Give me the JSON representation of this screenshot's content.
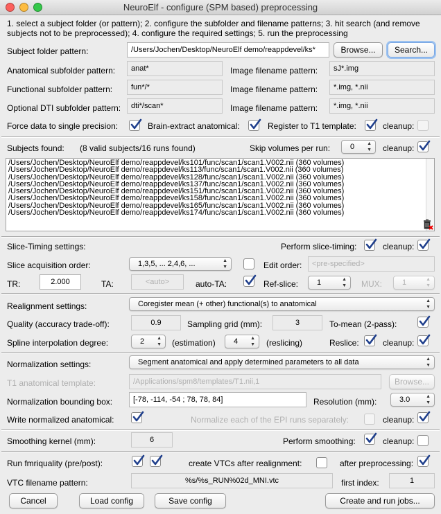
{
  "window": {
    "title": "NeuroElf - configure (SPM based) preprocessing"
  },
  "instructions": [
    "1. select a subject folder (or pattern); 2. configure the subfolder and filename patterns; 3. hit search (and remove",
    "subjects not to be preprocessed); 4. configure the required settings; 5. run the preprocessing"
  ],
  "folder": {
    "subject_label": "Subject folder pattern:",
    "subject_value": "/Users/Jochen/Desktop/NeuroElf demo/reappdevel/ks*",
    "browse": "Browse...",
    "search": "Search...",
    "anat_label": "Anatomical subfolder pattern:",
    "anat_value": "anat*",
    "anat_img_label": "Image filename pattern:",
    "anat_img_value": "sJ*.img",
    "func_label": "Functional subfolder pattern:",
    "func_value": "fun*/*",
    "func_img_label": "Image filename pattern:",
    "func_img_value": "*.img, *.nii",
    "dti_label": "Optional DTI subfolder pattern:",
    "dti_value": "dti*/scan*",
    "dti_img_label": "Image filename pattern:",
    "dti_img_value": "*.img, *.nii",
    "force_single": "Force data to single precision:",
    "brain_extract": "Brain-extract anatomical:",
    "register_t1": "Register to T1 template:",
    "cleanup": "cleanup:"
  },
  "subjects": {
    "label": "Subjects found:",
    "summary": "(8 valid subjects/16 runs found)",
    "skip_label": "Skip volumes per run:",
    "skip_value": "0",
    "cleanup": "cleanup:",
    "rows": [
      "/Users/Jochen/Desktop/NeuroElf demo/reappdevel/ks101/func/scan1/scan1.V002.nii (360 volumes)",
      "/Users/Jochen/Desktop/NeuroElf demo/reappdevel/ks113/func/scan1/scan1.V002.nii (360 volumes)",
      "/Users/Jochen/Desktop/NeuroElf demo/reappdevel/ks128/func/scan1/scan1.V002.nii (360 volumes)",
      "/Users/Jochen/Desktop/NeuroElf demo/reappdevel/ks137/func/scan1/scan1.V002.nii (360 volumes)",
      "/Users/Jochen/Desktop/NeuroElf demo/reappdevel/ks151/func/scan1/scan1.V002.nii (360 volumes)",
      "/Users/Jochen/Desktop/NeuroElf demo/reappdevel/ks158/func/scan1/scan1.V002.nii (360 volumes)",
      "/Users/Jochen/Desktop/NeuroElf demo/reappdevel/ks165/func/scan1/scan1.V002.nii (360 volumes)",
      "/Users/Jochen/Desktop/NeuroElf demo/reappdevel/ks174/func/scan1/scan1.V002.nii (360 volumes)"
    ],
    "trash_icon": "trash-icon"
  },
  "slice_timing": {
    "label": "Slice-Timing settings:",
    "perform_label": "Perform slice-timing:",
    "cleanup": "cleanup:",
    "order_label": "Slice acquisition order:",
    "order_value": "1,3,5, ... 2,4,6, ...",
    "edit_order_label": "Edit order:",
    "edit_order_value": "<pre-specified>",
    "tr_label": "TR:",
    "tr_value": "2.000",
    "ta_label": "TA:",
    "ta_value": "<auto>",
    "auto_ta_label": "auto-TA:",
    "ref_slice_label": "Ref-slice:",
    "ref_slice_value": "1",
    "mux_label": "MUX:",
    "mux_value": "1"
  },
  "realignment": {
    "label": "Realignment settings:",
    "mode_value": "Coregister mean (+ other) functional(s) to anatomical",
    "quality_label": "Quality (accuracy trade-off):",
    "quality_value": "0.9",
    "grid_label": "Sampling grid (mm):",
    "grid_value": "3",
    "to_mean_label": "To-mean (2-pass):",
    "spline_label": "Spline interpolation degree:",
    "spline_est_value": "2",
    "estimation_label": "(estimation)",
    "spline_res_value": "4",
    "reslicing_label": "(reslicing)",
    "reslice_label": "Reslice:",
    "cleanup": "cleanup:"
  },
  "normalization": {
    "label": "Normalization settings:",
    "mode_value": "Segment anatomical and apply determined parameters to all data",
    "template_label": "T1 anatomical template:",
    "template_value": "/Applications/spm8/templates/T1.nii,1",
    "browse": "Browse...",
    "bbox_label": "Normalization bounding box:",
    "bbox_value": "[-78, -114, -54 ; 78, 78, 84]",
    "resolution_label": "Resolution (mm):",
    "resolution_value": "3.0",
    "write_anat_label": "Write normalized anatomical:",
    "normalize_each_label": "Normalize each of the EPI runs separately:",
    "cleanup": "cleanup:"
  },
  "smoothing": {
    "label": "Smoothing kernel (mm):",
    "value": "6",
    "perform_label": "Perform smoothing:",
    "cleanup": "cleanup:"
  },
  "fmriquality": {
    "label": "Run fmriquality (pre/post):",
    "vtc_after_label": "create VTCs after realignment:",
    "after_pre_label": "after preprocessing:",
    "vtc_pattern_label": "VTC filename pattern:",
    "vtc_pattern_value": "%s/%s_RUN%02d_MNI.vtc",
    "first_index_label": "first index:",
    "first_index_value": "1"
  },
  "buttons": {
    "cancel": "Cancel",
    "load_config": "Load config",
    "save_config": "Save config",
    "create_run": "Create and run jobs..."
  },
  "checkboxes": {
    "force_single": true,
    "brain_extract": true,
    "register_t1": true,
    "register_cleanup": false,
    "subjects_cleanup": true,
    "slice_timing": true,
    "slice_cleanup": true,
    "edit_order": false,
    "auto_ta": true,
    "to_mean": true,
    "reslice": true,
    "realign_cleanup": true,
    "write_anat": true,
    "normalize_each": false,
    "norm_cleanup": true,
    "smoothing": true,
    "smooth_cleanup": false,
    "fmriquality_pre": true,
    "fmriquality_post": true,
    "vtc_after_realign": false,
    "vtc_after_pre": true
  },
  "colors": {
    "window_bg": "#ececec",
    "close": "#fc605c",
    "minimize": "#fdbc40",
    "zoom": "#34c84a",
    "check": "#1f3f8c"
  }
}
